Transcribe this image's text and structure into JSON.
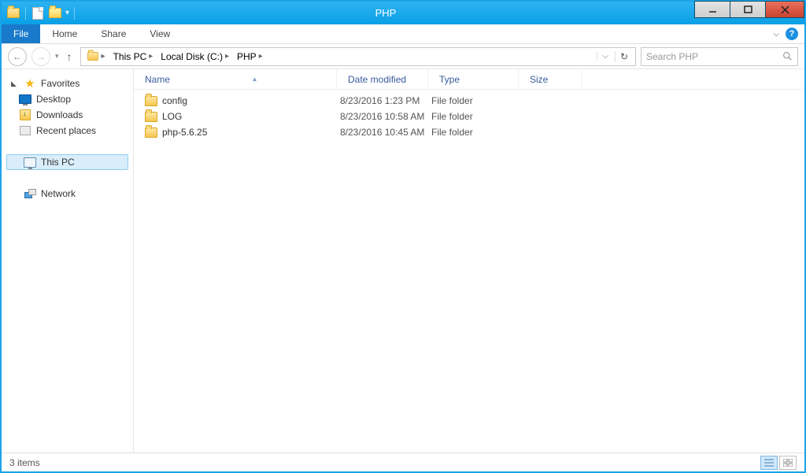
{
  "window": {
    "title": "PHP"
  },
  "ribbon": {
    "file": "File",
    "tabs": [
      "Home",
      "Share",
      "View"
    ]
  },
  "breadcrumb": {
    "items": [
      "This PC",
      "Local Disk (C:)",
      "PHP"
    ]
  },
  "search": {
    "placeholder": "Search PHP"
  },
  "sidebar": {
    "favorites": {
      "label": "Favorites",
      "items": [
        {
          "label": "Desktop"
        },
        {
          "label": "Downloads"
        },
        {
          "label": "Recent places"
        }
      ]
    },
    "thispc": {
      "label": "This PC"
    },
    "network": {
      "label": "Network"
    }
  },
  "columns": {
    "name": "Name",
    "date": "Date modified",
    "type": "Type",
    "size": "Size"
  },
  "files": [
    {
      "name": "config",
      "date": "8/23/2016 1:23 PM",
      "type": "File folder"
    },
    {
      "name": "LOG",
      "date": "8/23/2016 10:58 AM",
      "type": "File folder"
    },
    {
      "name": "php-5.6.25",
      "date": "8/23/2016 10:45 AM",
      "type": "File folder"
    }
  ],
  "status": {
    "text": "3 items"
  }
}
